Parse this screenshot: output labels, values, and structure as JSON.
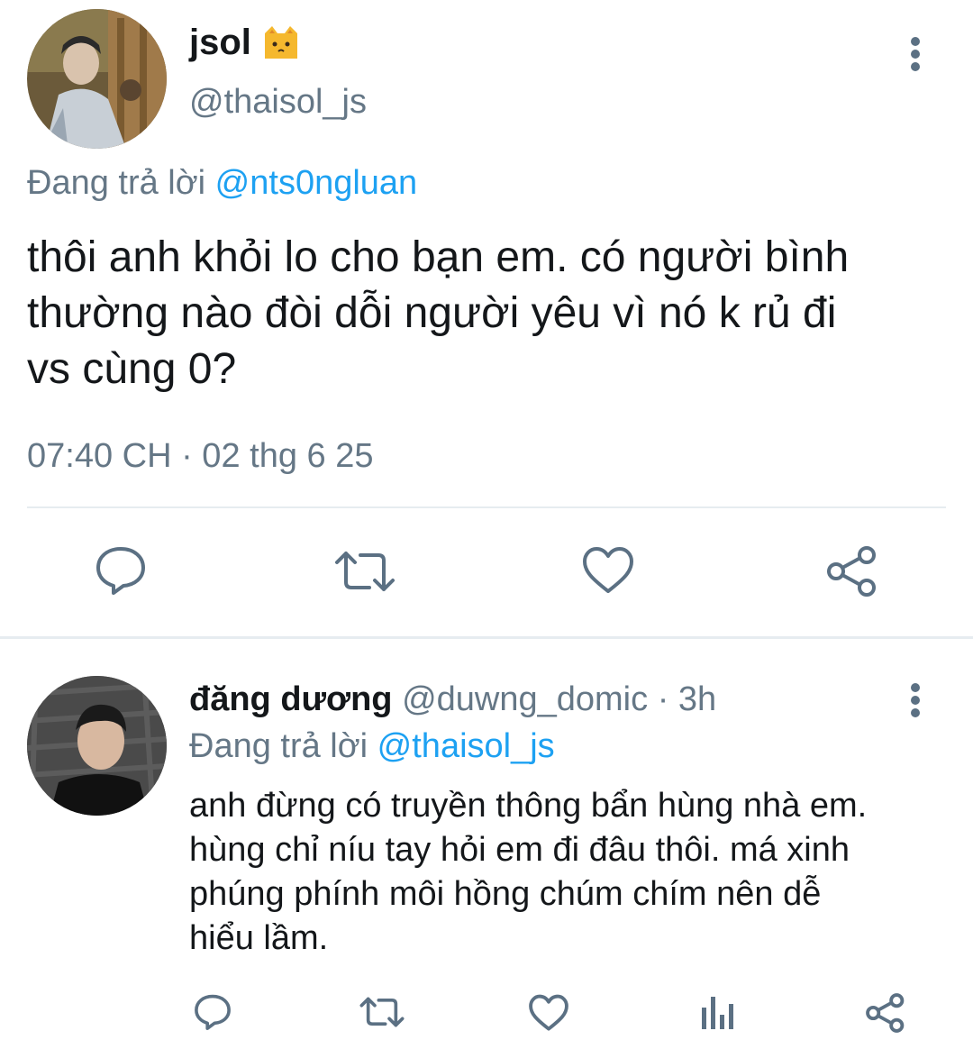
{
  "main_tweet": {
    "display_name": "jsol",
    "emoji": "🐱",
    "handle": "@thaisol_js",
    "reply_prefix": "Đang trả lời",
    "reply_to": "@nts0ngluan",
    "text_lines": [
      "thôi anh khỏi lo cho bạn em. có người bình",
      "thường nào đòi dỗi người yêu vì nó k rủ đi",
      "vs cùng 0?"
    ],
    "timestamp": "07:40 CH · 02 thg 6 25",
    "actions": [
      "reply-icon",
      "retweet-icon",
      "like-icon",
      "share-icon"
    ]
  },
  "reply_tweet": {
    "display_name": "đăng dương",
    "handle": "@duwng_domic",
    "dot_time": "· 3h",
    "reply_prefix": "Đang trả lời",
    "reply_to": "@thaisol_js",
    "text_lines": [
      "anh đừng có truyền thông bẩn hùng nhà em.",
      "hùng chỉ níu tay hỏi em đi đâu thôi. má xinh",
      "phúng phính môi hồng chúm chím nên dễ",
      "hiểu lầm."
    ],
    "actions": [
      "reply-icon",
      "retweet-icon",
      "like-icon",
      "analytics-icon",
      "share-icon"
    ]
  },
  "colors": {
    "accent": "#1da1f2",
    "muted": "#657786",
    "icon": "#5b7083",
    "divider": "#e6ecf0"
  }
}
